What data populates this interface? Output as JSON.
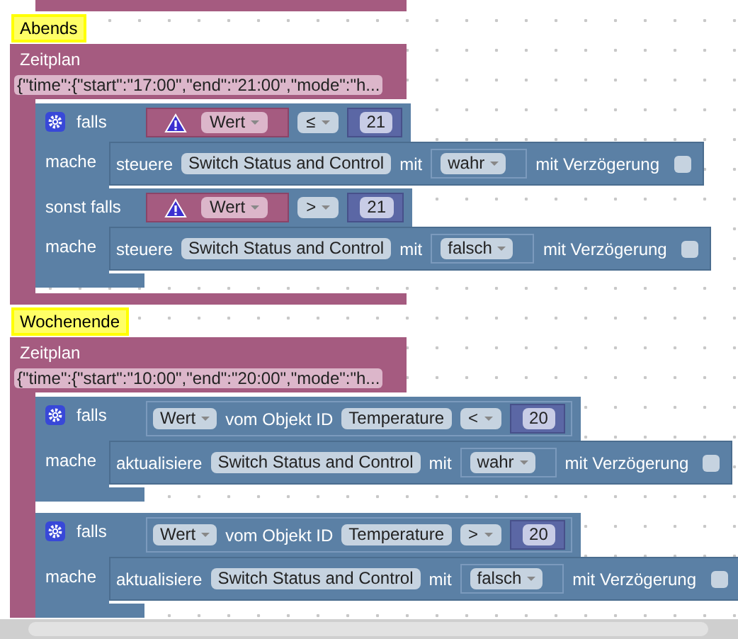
{
  "schedules": [
    {
      "comment": "Abends",
      "title": "Zeitplan",
      "config": "{\"time\":{\"start\":\"17:00\",\"end\":\"21:00\",\"mode\":\"h...",
      "if_blocks": [
        {
          "branches": [
            {
              "label": "falls",
              "condition": {
                "kind": "value",
                "warning": true,
                "field": "Wert",
                "operator": "≤",
                "number": "21"
              },
              "do_label": "mache",
              "action": {
                "verb": "steuere",
                "target": "Switch Status and Control",
                "with_label": "mit",
                "value": "wahr",
                "delay_label": "mit Verzögerung",
                "delay": false
              }
            },
            {
              "label": "sonst falls",
              "condition": {
                "kind": "value",
                "warning": true,
                "field": "Wert",
                "operator": ">",
                "number": "21"
              },
              "do_label": "mache",
              "action": {
                "verb": "steuere",
                "target": "Switch Status and Control",
                "with_label": "mit",
                "value": "falsch",
                "delay_label": "mit Verzögerung",
                "delay": false
              }
            }
          ]
        }
      ]
    },
    {
      "comment": "Wochenende",
      "title": "Zeitplan",
      "config": "{\"time\":{\"start\":\"10:00\",\"end\":\"20:00\",\"mode\":\"h...",
      "if_blocks": [
        {
          "branches": [
            {
              "label": "falls",
              "condition": {
                "kind": "object",
                "field": "Wert",
                "of_label": "vom Objekt ID",
                "object": "Temperature",
                "operator": "<",
                "number": "20"
              },
              "do_label": "mache",
              "action": {
                "verb": "aktualisiere",
                "target": "Switch Status and Control",
                "with_label": "mit",
                "value": "wahr",
                "delay_label": "mit Verzögerung",
                "delay": false
              }
            }
          ]
        },
        {
          "branches": [
            {
              "label": "falls",
              "condition": {
                "kind": "object",
                "field": "Wert",
                "of_label": "vom Objekt ID",
                "object": "Temperature",
                "operator": ">",
                "number": "20"
              },
              "do_label": "mache",
              "action": {
                "verb": "aktualisiere",
                "target": "Switch Status and Control",
                "with_label": "mit",
                "value": "falsch",
                "delay_label": "mit Verzögerung",
                "delay": false
              }
            }
          ]
        }
      ]
    }
  ]
}
